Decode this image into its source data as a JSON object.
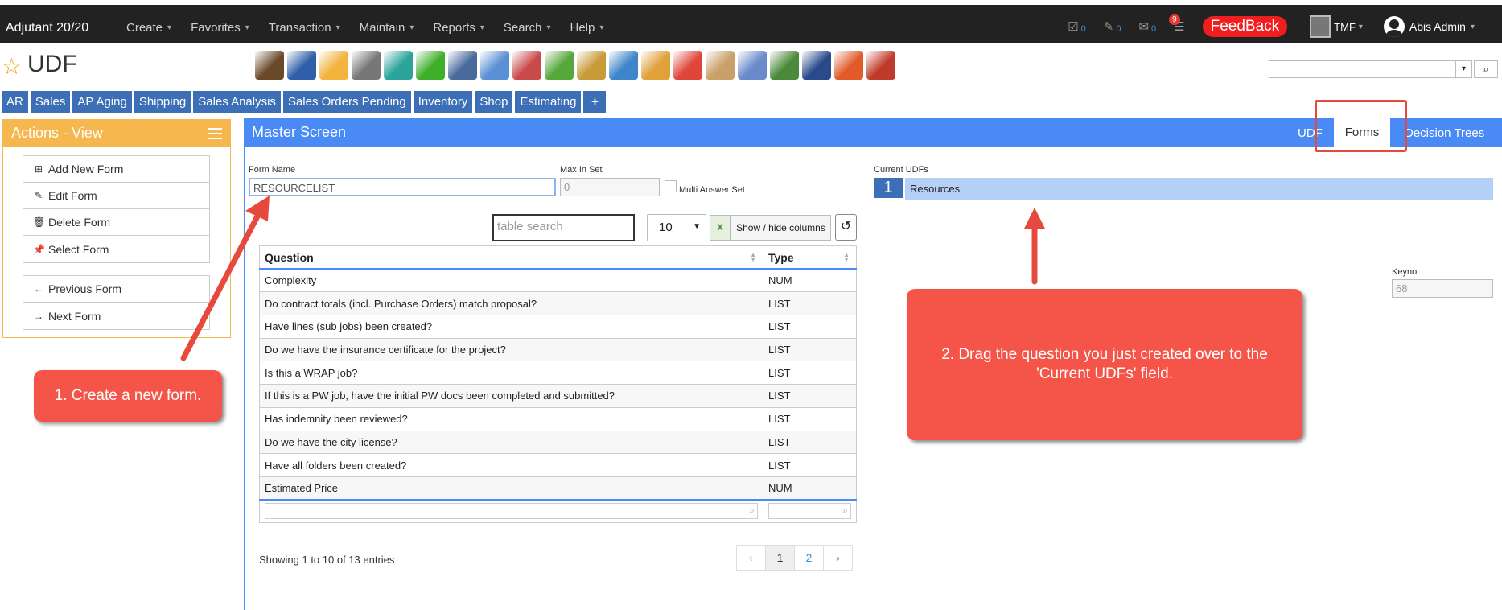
{
  "nav": {
    "brand": "Adjutant 20/20",
    "menu": [
      "Create",
      "Favorites",
      "Transaction",
      "Maintain",
      "Reports",
      "Search",
      "Help"
    ],
    "tasks_count": "0",
    "notes_count": "0",
    "mail_count": "0",
    "alerts_badge": "9",
    "feedback": "FeedBack",
    "company": "TMF",
    "user": "Abis Admin"
  },
  "page": {
    "title": "UDF"
  },
  "toolbar_icons": [
    {
      "name": "bank-icon",
      "color": "#6b4a2a"
    },
    {
      "name": "person-icon",
      "color": "#2e5fa8"
    },
    {
      "name": "weather-icon",
      "color": "#f3b33d"
    },
    {
      "name": "calendar-16-icon",
      "color": "#777777"
    },
    {
      "name": "clock-icon",
      "color": "#2aa39a"
    },
    {
      "name": "checkmark-icon",
      "color": "#3fae2a"
    },
    {
      "name": "keyboard-icon",
      "color": "#4a6a9c"
    },
    {
      "name": "magnifier-icon",
      "color": "#5b8fd6"
    },
    {
      "name": "monitor-icon",
      "color": "#c94a4a"
    },
    {
      "name": "basket-icon",
      "color": "#56a83a"
    },
    {
      "name": "box-in-icon",
      "color": "#c99a3a"
    },
    {
      "name": "box-out-icon",
      "color": "#3e86c9"
    },
    {
      "name": "hand-coins-icon",
      "color": "#e0a03a"
    },
    {
      "name": "speech-dollar-icon",
      "color": "#e0453a"
    },
    {
      "name": "clipboard-icon",
      "color": "#c9a06a"
    },
    {
      "name": "pencil-paper-icon",
      "color": "#6a8ac9"
    },
    {
      "name": "money-icon",
      "color": "#4a8a3a"
    },
    {
      "name": "globe-book-icon",
      "color": "#2a4a8a"
    },
    {
      "name": "sync-icon",
      "color": "#e05a2a"
    },
    {
      "name": "bricks-icon",
      "color": "#c03a2a"
    }
  ],
  "quick_links": [
    "AR",
    "Sales",
    "AP Aging",
    "Shipping",
    "Sales Analysis",
    "Sales Orders Pending",
    "Inventory",
    "Shop",
    "Estimating",
    "+"
  ],
  "actions": {
    "title": "Actions - View",
    "group1": [
      "Add New Form",
      "Edit Form",
      "Delete Form",
      "Select Form"
    ],
    "group2": [
      "Previous Form",
      "Next Form"
    ]
  },
  "master": {
    "title": "Master Screen",
    "tabs": [
      "UDF",
      "Forms",
      "Decision Trees"
    ],
    "active_tab": "Forms"
  },
  "form": {
    "form_name_label": "Form Name",
    "form_name_value": "RESOURCELIST",
    "max_in_set_label": "Max In Set",
    "max_in_set_value": "0",
    "multi_answer_label": "Multi Answer Set",
    "current_udfs_label": "Current UDFs",
    "keyno_label": "Keyno",
    "keyno_value": "68"
  },
  "table": {
    "search_placeholder": "table search",
    "page_length": "10",
    "excel_label": "X",
    "show_hide_label": "Show / hide columns",
    "reset_glyph": "↺",
    "columns": [
      "Question",
      "Type"
    ],
    "rows": [
      [
        "Complexity",
        "NUM"
      ],
      [
        "Do contract totals (incl. Purchase Orders) match proposal?",
        "LIST"
      ],
      [
        "Have lines (sub jobs) been created?",
        "LIST"
      ],
      [
        "Do we have the insurance certificate for the project?",
        "LIST"
      ],
      [
        "Is this a WRAP job?",
        "LIST"
      ],
      [
        "If this is a PW job, have the initial PW docs been completed and submitted?",
        "LIST"
      ],
      [
        "Has indemnity been reviewed?",
        "LIST"
      ],
      [
        "Do we have the city license?",
        "LIST"
      ],
      [
        "Have all folders been created?",
        "LIST"
      ],
      [
        "Estimated Price",
        "NUM"
      ]
    ],
    "showing": "Showing 1 to 10 of 13 entries",
    "pager": [
      "‹",
      "1",
      "2",
      "›"
    ]
  },
  "current_udfs": [
    {
      "num": "1",
      "name": "Resources"
    }
  ],
  "annotations": {
    "step1": "1. Create a new form.",
    "step2": "2. Drag the question you just created over to the 'Current UDFs' field."
  },
  "colors": {
    "accent_blue": "#4a8af4",
    "orange_panel": "#f6b74e",
    "callout_red": "#f55449",
    "feedback_red": "#f01e1e"
  }
}
